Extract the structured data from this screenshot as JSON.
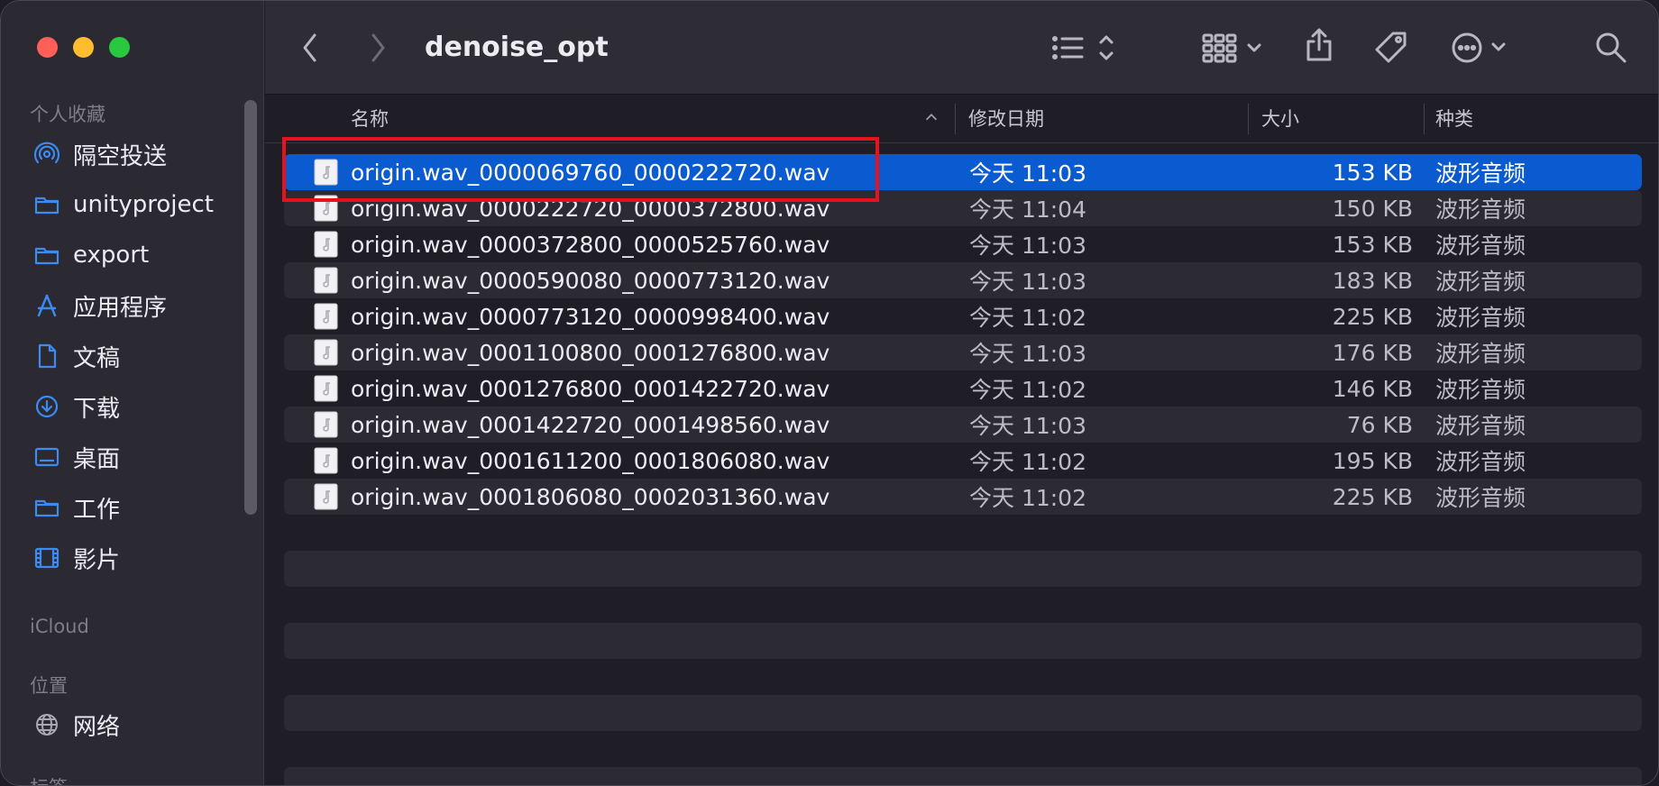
{
  "window": {
    "title": "denoise_opt"
  },
  "sidebar": {
    "sections": {
      "favorites": "个人收藏",
      "icloud": "iCloud",
      "locations": "位置",
      "tags": "标签"
    },
    "items": [
      {
        "label": "隔空投送",
        "icon": "airdrop-icon"
      },
      {
        "label": "unityproject",
        "icon": "folder-icon"
      },
      {
        "label": "export",
        "icon": "folder-icon"
      },
      {
        "label": "应用程序",
        "icon": "applications-icon"
      },
      {
        "label": "文稿",
        "icon": "document-icon"
      },
      {
        "label": "下载",
        "icon": "download-icon"
      },
      {
        "label": "桌面",
        "icon": "desktop-icon"
      },
      {
        "label": "工作",
        "icon": "folder-icon"
      },
      {
        "label": "影片",
        "icon": "film-icon"
      }
    ],
    "network": {
      "label": "网络",
      "icon": "globe-icon"
    }
  },
  "columns": {
    "name": "名称",
    "date": "修改日期",
    "size": "大小",
    "kind": "种类"
  },
  "files": [
    {
      "name": "origin.wav_0000069760_0000222720.wav",
      "date": "今天 11:03",
      "size": "153 KB",
      "kind": "波形音频"
    },
    {
      "name": "origin.wav_0000222720_0000372800.wav",
      "date": "今天 11:04",
      "size": "150 KB",
      "kind": "波形音频"
    },
    {
      "name": "origin.wav_0000372800_0000525760.wav",
      "date": "今天 11:03",
      "size": "153 KB",
      "kind": "波形音频"
    },
    {
      "name": "origin.wav_0000590080_0000773120.wav",
      "date": "今天 11:03",
      "size": "183 KB",
      "kind": "波形音频"
    },
    {
      "name": "origin.wav_0000773120_0000998400.wav",
      "date": "今天 11:02",
      "size": "225 KB",
      "kind": "波形音频"
    },
    {
      "name": "origin.wav_0001100800_0001276800.wav",
      "date": "今天 11:03",
      "size": "176 KB",
      "kind": "波形音频"
    },
    {
      "name": "origin.wav_0001276800_0001422720.wav",
      "date": "今天 11:02",
      "size": "146 KB",
      "kind": "波形音频"
    },
    {
      "name": "origin.wav_0001422720_0001498560.wav",
      "date": "今天 11:03",
      "size": "76 KB",
      "kind": "波形音频"
    },
    {
      "name": "origin.wav_0001611200_0001806080.wav",
      "date": "今天 11:02",
      "size": "195 KB",
      "kind": "波形音频"
    },
    {
      "name": "origin.wav_0001806080_0002031360.wav",
      "date": "今天 11:02",
      "size": "225 KB",
      "kind": "波形音频"
    }
  ],
  "selected_index": 0,
  "colors": {
    "selection": "#0a5ad0",
    "annotation_box": "#e8121e",
    "accent_icon": "#3d8bf0"
  }
}
